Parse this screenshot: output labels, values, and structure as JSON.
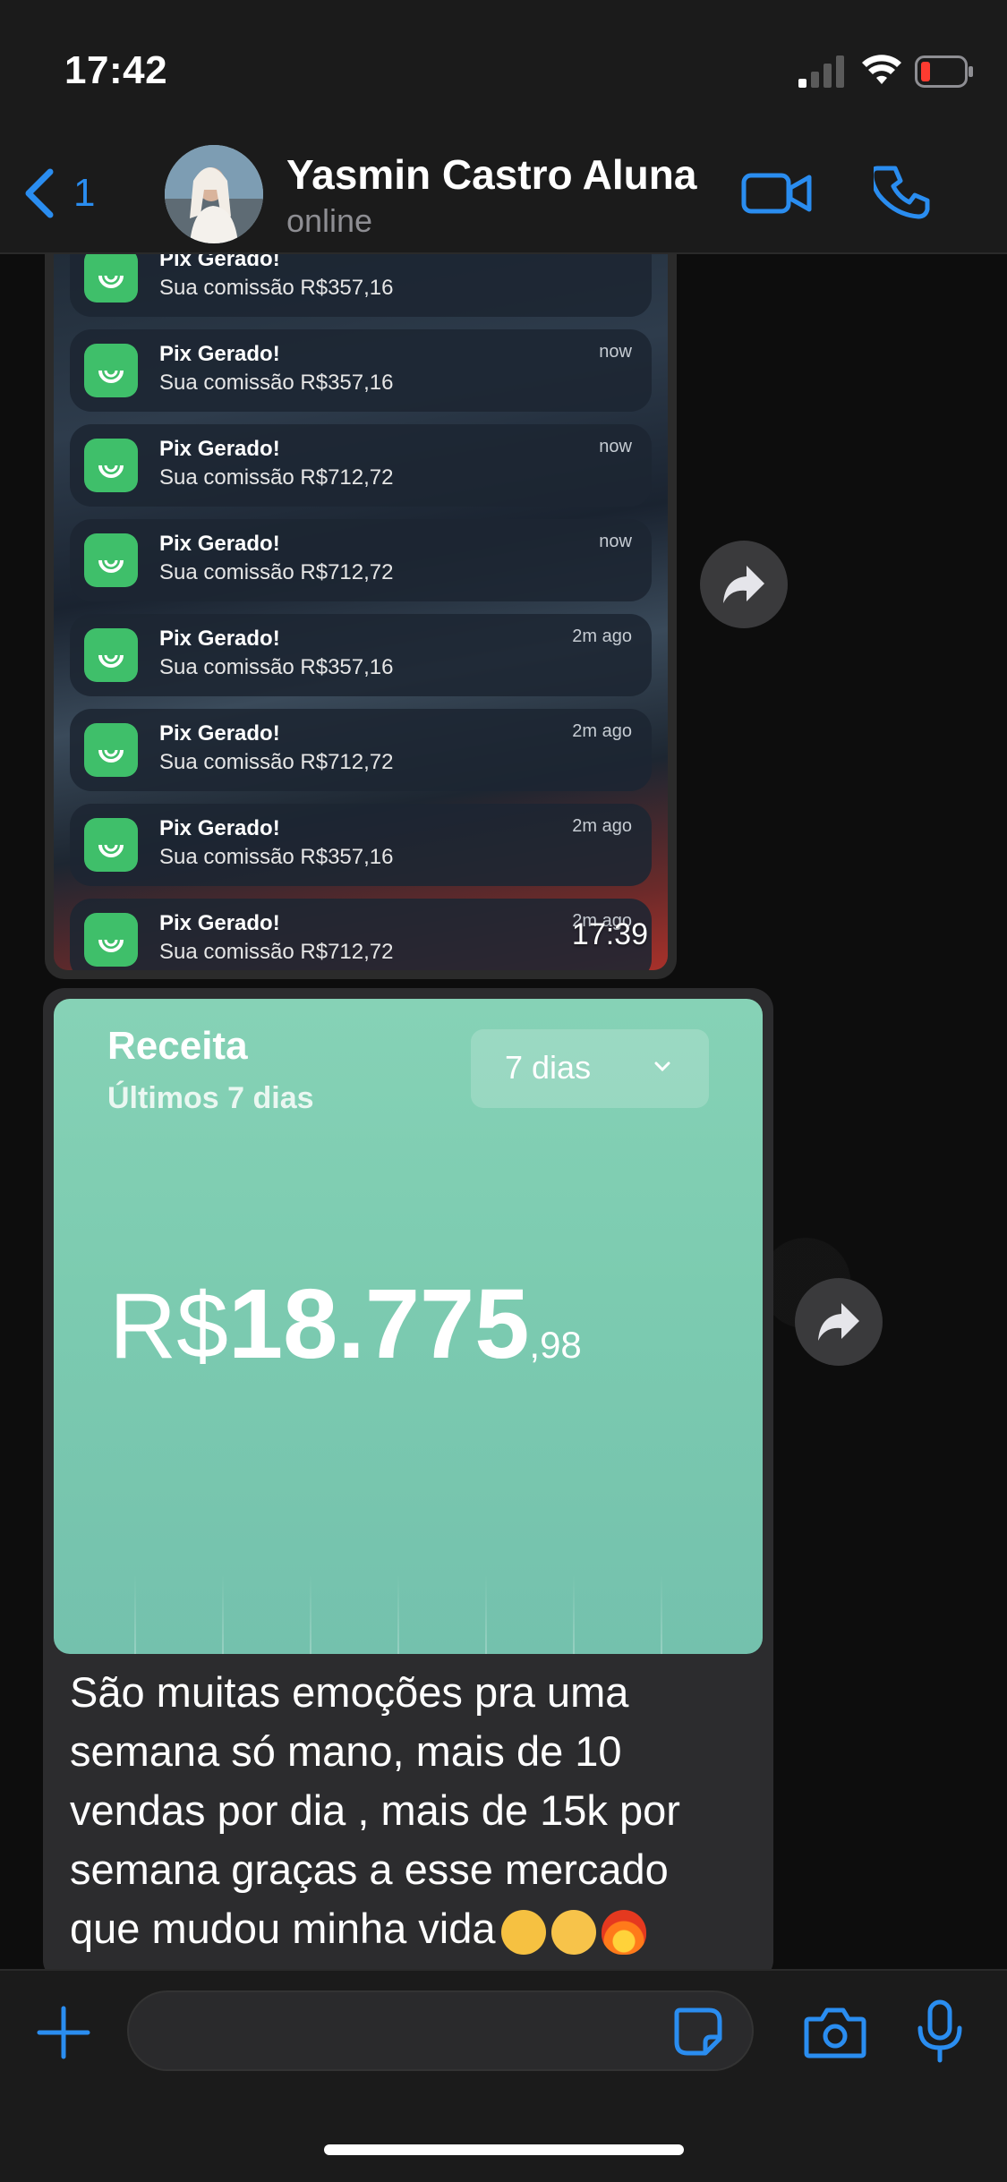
{
  "status_bar": {
    "time": "17:42"
  },
  "header": {
    "back_count": "1",
    "contact_name": "Yasmin Castro Aluna",
    "contact_status": "online"
  },
  "notifications": [
    {
      "title": "Pix Gerado!",
      "body": "Sua comissão R$357,16",
      "time": ""
    },
    {
      "title": "Pix Gerado!",
      "body": "Sua comissão R$357,16",
      "time": "now"
    },
    {
      "title": "Pix Gerado!",
      "body": "Sua comissão R$712,72",
      "time": "now"
    },
    {
      "title": "Pix Gerado!",
      "body": "Sua comissão R$712,72",
      "time": "now"
    },
    {
      "title": "Pix Gerado!",
      "body": "Sua comissão R$357,16",
      "time": "2m ago"
    },
    {
      "title": "Pix Gerado!",
      "body": "Sua comissão R$712,72",
      "time": "2m ago"
    },
    {
      "title": "Pix Gerado!",
      "body": "Sua comissão R$357,16",
      "time": "2m ago"
    },
    {
      "title": "Pix Gerado!",
      "body": "Sua comissão R$712,72",
      "time": "2m ago"
    }
  ],
  "message1": {
    "time": "17:39"
  },
  "revenue_card": {
    "title": "Receita",
    "subtitle": "Últimos 7 dias",
    "period_select": "7 dias",
    "currency": "R$",
    "amount": "18.775",
    "decimals": ",98"
  },
  "message2": {
    "text": "São muitas emoções pra uma semana só mano, mais de 10 vendas por dia , mais de 15k por semana graças a esse mercado que mudou minha vida"
  },
  "icons": {
    "back": "chevron-left-icon",
    "video": "video-call-icon",
    "call": "phone-icon",
    "forward": "forward-icon",
    "plus": "plus-icon",
    "sticker": "sticker-icon",
    "camera": "camera-icon",
    "mic": "microphone-icon"
  },
  "colors": {
    "accent": "#2a8df0",
    "pix_green": "#3fbf6a",
    "card_green": "#7ccbb0"
  }
}
